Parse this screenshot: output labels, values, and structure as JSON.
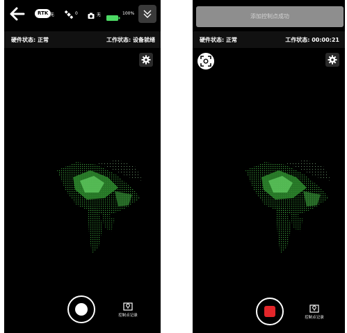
{
  "left_screen": {
    "topbar": {
      "rtk_badge": "RTK",
      "rtk_value": "无",
      "satellite_count": "0",
      "camera_status": "无",
      "battery_percent": "100%",
      "battery_level": 1.0
    },
    "status": {
      "hardware": "硬件状态: 正常",
      "work": "工作状态: 设备就绪"
    },
    "control_point_record": "控制点记录"
  },
  "right_screen": {
    "toast": "添加控制点成功",
    "status": {
      "hardware": "硬件状态: 正常",
      "work": "工作状态: 00:00:21"
    },
    "control_point_record": "控制点记录"
  },
  "colors": {
    "background": "#000000",
    "record_red": "#e3262a",
    "battery_green": "#4cd964",
    "pointcloud_green": "#3fae3f"
  }
}
